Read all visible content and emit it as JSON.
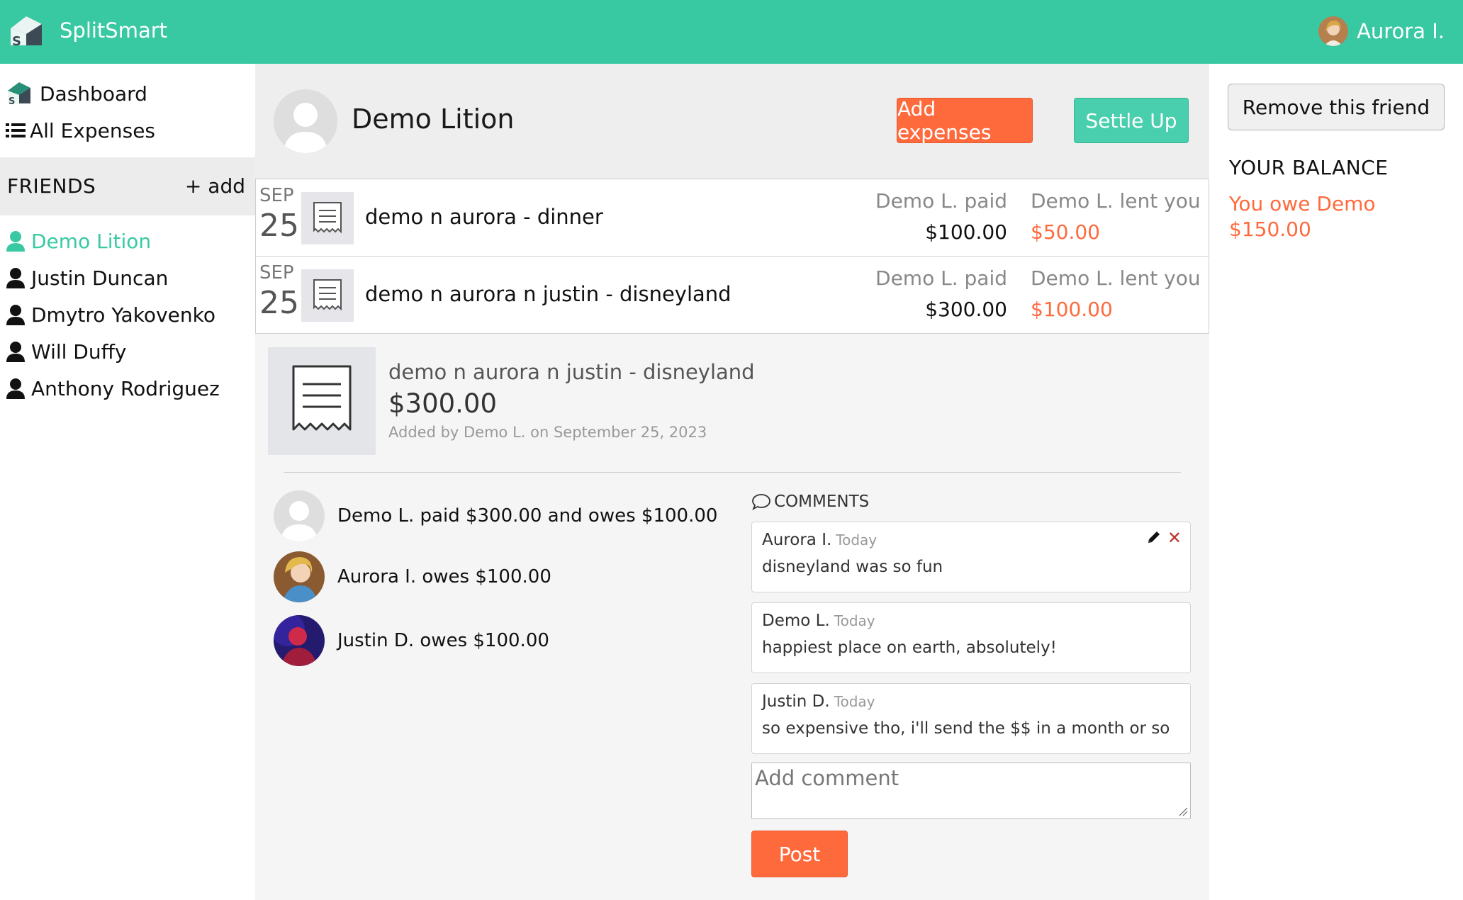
{
  "app": {
    "name": "SplitSmart",
    "accent": "#38c9a3",
    "warn": "#ff6a3d"
  },
  "user": {
    "name": "Aurora I."
  },
  "nav": {
    "dashboard": "Dashboard",
    "all_expenses": "All Expenses"
  },
  "friends": {
    "title": "FRIENDS",
    "add": "+ add",
    "list": [
      "Demo Lition",
      "Justin Duncan",
      "Dmytro Yakovenko",
      "Will Duffy",
      "Anthony Rodriguez"
    ]
  },
  "header": {
    "friend_name": "Demo Lition",
    "add_expenses": "Add expenses",
    "settle_up": "Settle Up"
  },
  "expenses": [
    {
      "month": "SEP",
      "day": "25",
      "description": "demo n aurora - dinner",
      "paid_label": "Demo L. paid",
      "paid_amount": "$100.00",
      "lent_label": "Demo L. lent you",
      "lent_amount": "$50.00"
    },
    {
      "month": "SEP",
      "day": "25",
      "description": "demo n aurora n justin - disneyland",
      "paid_label": "Demo L. paid",
      "paid_amount": "$300.00",
      "lent_label": "Demo L. lent you",
      "lent_amount": "$100.00"
    }
  ],
  "detail": {
    "title": "demo n aurora n justin - disneyland",
    "amount": "$300.00",
    "added": "Added by Demo L. on September 25, 2023",
    "splits": [
      "Demo L. paid $300.00 and owes $100.00",
      "Aurora I. owes $100.00",
      "Justin D. owes $100.00"
    ]
  },
  "comments": {
    "title": "COMMENTS",
    "items": [
      {
        "author": "Aurora I.",
        "date": "Today",
        "text": "disneyland was so fun"
      },
      {
        "author": "Demo L.",
        "date": "Today",
        "text": "happiest place on earth, absolutely!"
      },
      {
        "author": "Justin D.",
        "date": "Today",
        "text": "so expensive tho, i'll send the $$ in a month or so"
      }
    ],
    "placeholder": "Add comment",
    "post": "Post"
  },
  "balance": {
    "remove_friend": "Remove this friend",
    "label": "YOUR BALANCE",
    "value": "You owe Demo $150.00"
  }
}
